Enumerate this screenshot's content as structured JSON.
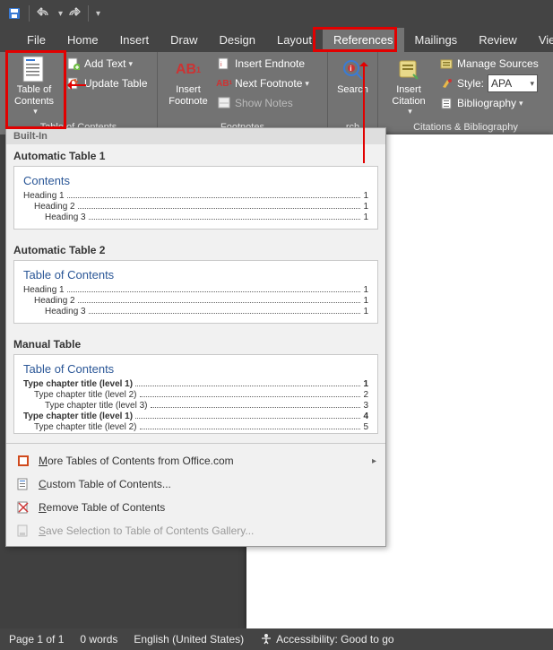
{
  "titlebar": {
    "save": "Save",
    "undo": "Undo",
    "redo": "Redo"
  },
  "tabs": [
    "File",
    "Home",
    "Insert",
    "Draw",
    "Design",
    "Layout",
    "References",
    "Mailings",
    "Review",
    "View"
  ],
  "active_tab": "References",
  "ribbon": {
    "toc": {
      "big": "Table of\nContents",
      "add_text": "Add Text",
      "update": "Update Table",
      "group": "Table of Contents"
    },
    "footnotes": {
      "big": "Insert\nFootnote",
      "ab_badge": "AB",
      "ab_sup": "1",
      "endnote": "Insert Endnote",
      "next": "Next Footnote",
      "show": "Show Notes",
      "group": "Footnotes"
    },
    "research": {
      "search": "Search",
      "group_partial": "rch"
    },
    "citations": {
      "big": "Insert\nCitation",
      "manage": "Manage Sources",
      "style_label": "Style:",
      "style_value": "APA",
      "biblio": "Bibliography",
      "group": "Citations & Bibliography"
    }
  },
  "gallery": {
    "builtin": "Built-In",
    "items": [
      {
        "title": "Automatic Table 1",
        "heading": "Contents",
        "lines": [
          {
            "label": "Heading 1",
            "indent": 0,
            "page": "1",
            "bold": false
          },
          {
            "label": "Heading 2",
            "indent": 1,
            "page": "1",
            "bold": false
          },
          {
            "label": "Heading 3",
            "indent": 2,
            "page": "1",
            "bold": false
          }
        ]
      },
      {
        "title": "Automatic Table 2",
        "heading": "Table of Contents",
        "lines": [
          {
            "label": "Heading 1",
            "indent": 0,
            "page": "1",
            "bold": false
          },
          {
            "label": "Heading 2",
            "indent": 1,
            "page": "1",
            "bold": false
          },
          {
            "label": "Heading 3",
            "indent": 2,
            "page": "1",
            "bold": false
          }
        ]
      },
      {
        "title": "Manual Table",
        "heading": "Table of Contents",
        "lines": [
          {
            "label": "Type chapter title (level 1)",
            "indent": 0,
            "page": "1",
            "bold": true
          },
          {
            "label": "Type chapter title (level 2)",
            "indent": 1,
            "page": "2",
            "bold": false
          },
          {
            "label": "Type chapter title (level 3)",
            "indent": 2,
            "page": "3",
            "bold": false
          },
          {
            "label": "Type chapter title (level 1)",
            "indent": 0,
            "page": "4",
            "bold": true
          },
          {
            "label": "Type chapter title (level 2)",
            "indent": 1,
            "page": "5",
            "bold": false
          }
        ]
      }
    ],
    "menu": {
      "more": "More Tables of Contents from Office.com",
      "custom": "Custom Table of Contents...",
      "remove": "Remove Table of Contents",
      "save_sel": "Save Selection to Table of Contents Gallery..."
    }
  },
  "status": {
    "page": "Page 1 of 1",
    "words": "0 words",
    "lang": "English (United States)",
    "access": "Accessibility: Good to go"
  }
}
